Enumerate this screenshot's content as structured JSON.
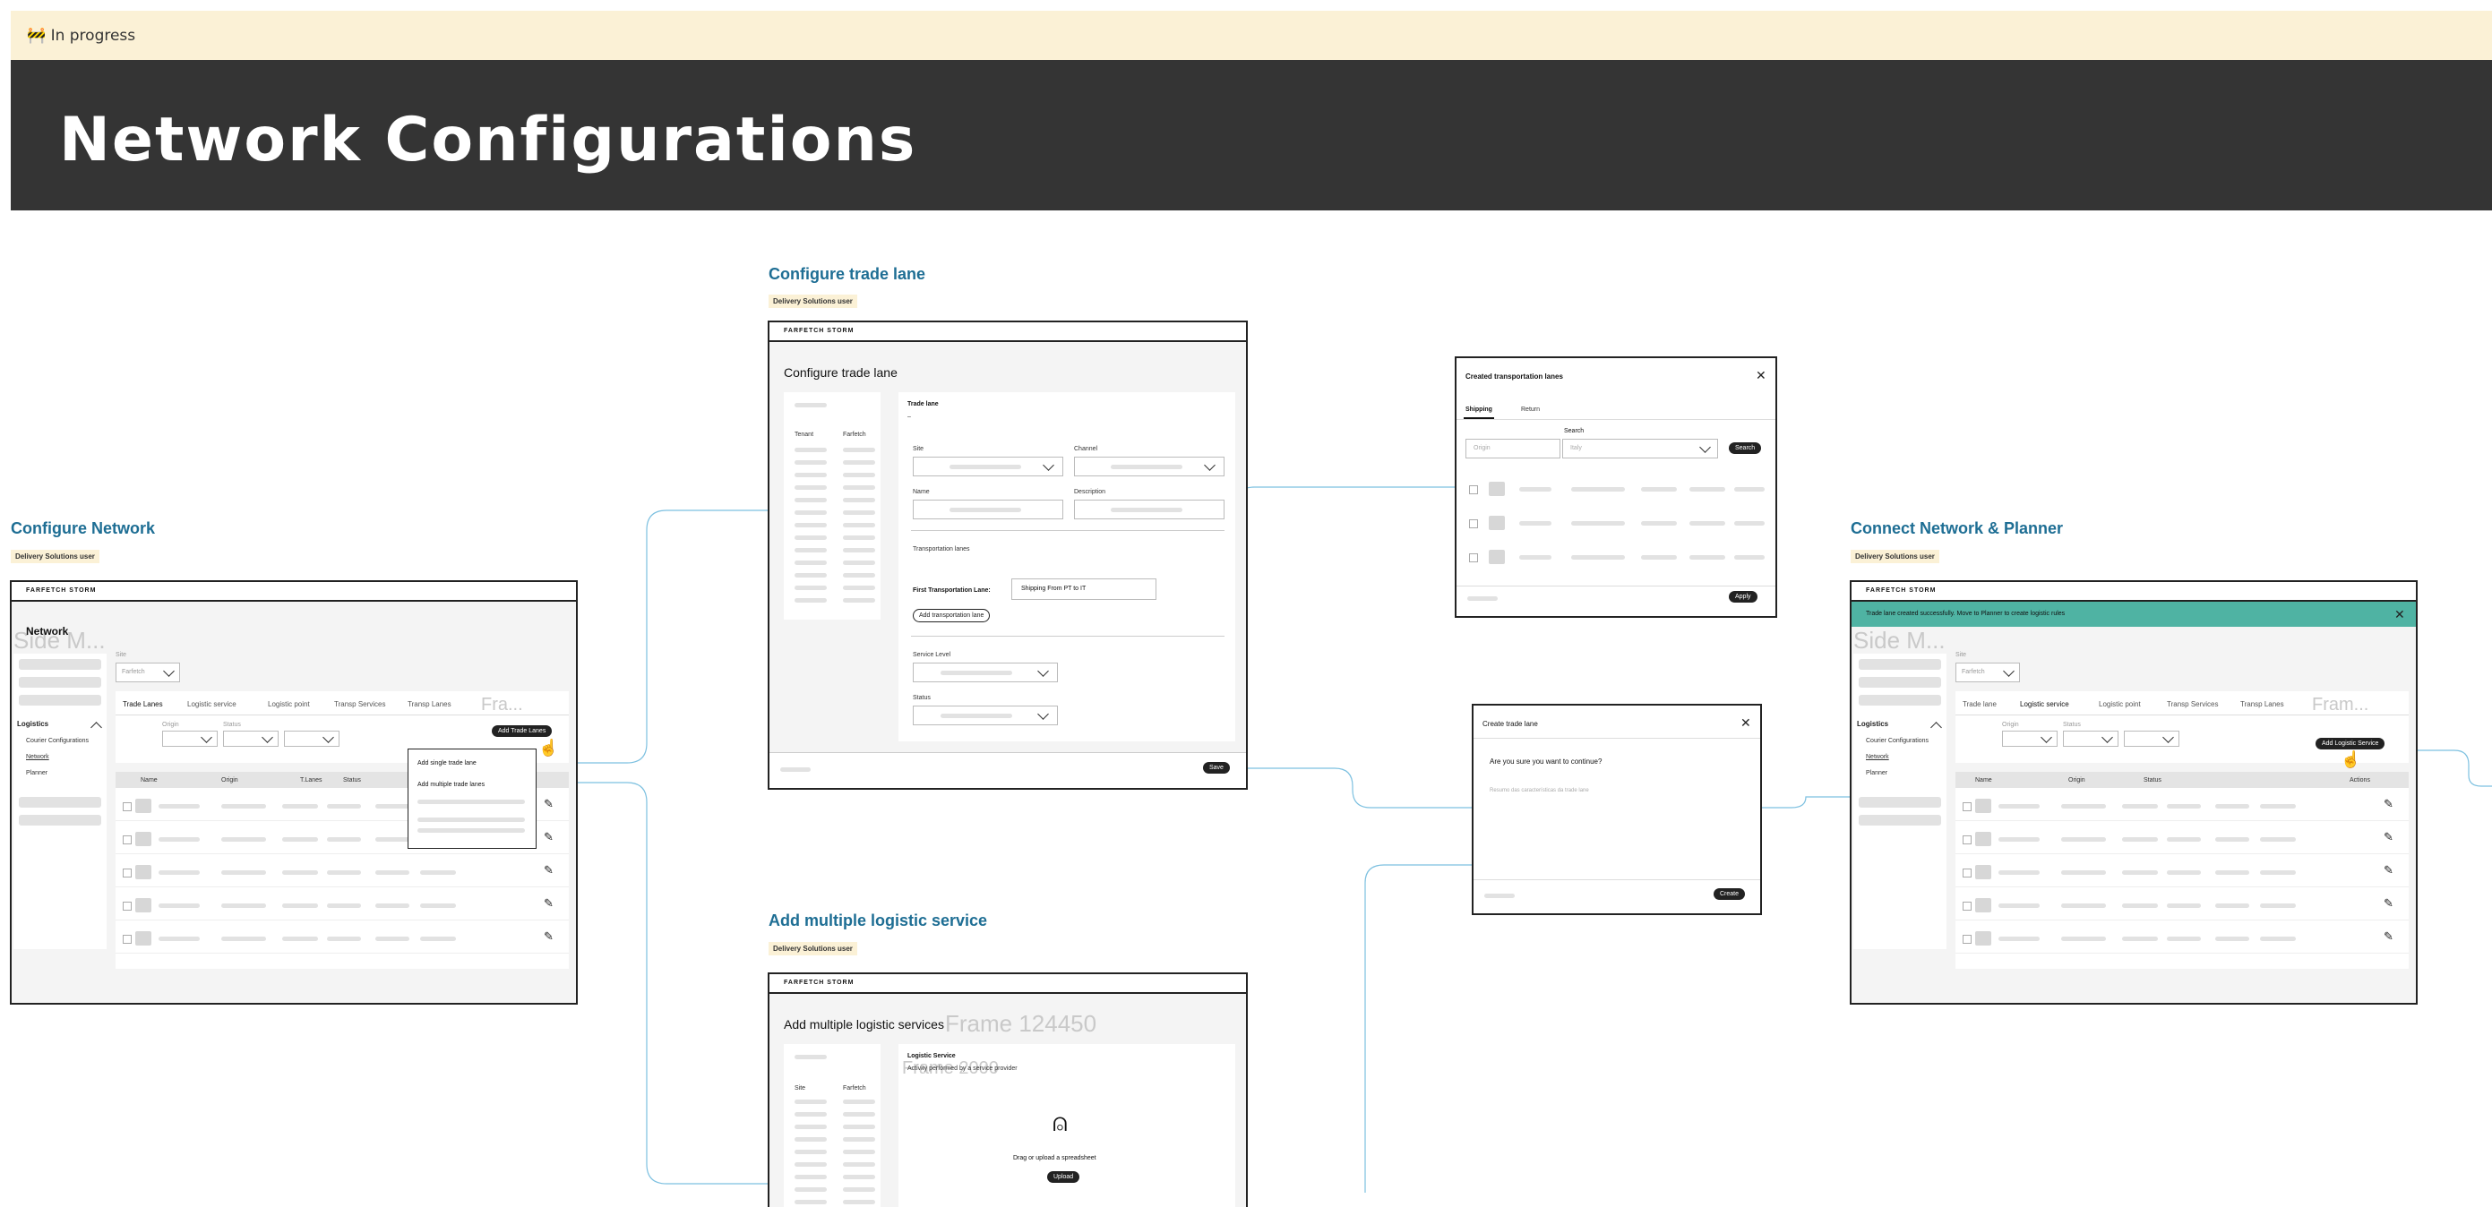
{
  "banner": {
    "icon": "construction-barrier-icon",
    "text": "🚧 In progress"
  },
  "hero": {
    "title": "Network Configurations"
  },
  "colors": {
    "accent": "#1e6e94",
    "success": "#4fb3a3",
    "tag_bg": "#fbf1d6",
    "dark": "#343434"
  },
  "configure_network": {
    "title": "Configure Network",
    "tag": "Delivery Solutions user",
    "brand": "FARFETCH STORM",
    "ghost": "Side M...",
    "heading": "Network",
    "site_label": "Site",
    "site_value": "Farfetch",
    "nav_section": "Logistics",
    "nav_items": [
      "Courier Configurations",
      "Network",
      "Planner"
    ],
    "tabs": [
      "Trade Lanes",
      "Logistic service",
      "Logistic point",
      "Transp Services",
      "Transp Lanes"
    ],
    "tab_ghost": "Fra...",
    "filters": [
      "Origin",
      "Status"
    ],
    "add_button": "Add Trade Lanes",
    "menu_items": [
      "Add single trade lane",
      "Add multiple trade lanes"
    ],
    "columns": [
      "Name",
      "Origin",
      "T.Lanes",
      "Status"
    ]
  },
  "configure_trade_lane": {
    "title": "Configure trade lane",
    "tag": "Delivery Solutions user",
    "brand": "FARFETCH STORM",
    "heading": "Configure trade lane",
    "side_labels": [
      "Tenant",
      "Farfetch"
    ],
    "section": "Trade lane",
    "dash": "–",
    "fields": [
      "Site",
      "Channel",
      "Name",
      "Description"
    ],
    "transport_label": "Transportation lanes",
    "first_lane_label": "First Transportation Lane:",
    "first_lane_value": "Shipping From PT to IT",
    "add_lane_button": "Add transportation lane",
    "service_level": "Service Level",
    "status": "Status",
    "save": "Save"
  },
  "created_lanes": {
    "title": "Created transportation lanes",
    "tabs": [
      "Shipping",
      "Return"
    ],
    "origin_placeholder": "Origin",
    "search_label": "Search",
    "search_placeholder": "Italy",
    "search_button": "Search",
    "apply": "Apply"
  },
  "create_trade_lane": {
    "title": "Create trade lane",
    "question": "Are you sure you want to continue?",
    "summary": "Resumo das características da trade lane",
    "create": "Create"
  },
  "add_logistic": {
    "title": "Add multiple logistic service",
    "tag": "Delivery Solutions user",
    "brand": "FARFETCH STORM",
    "heading": "Add multiple logistic services",
    "ghost1": "Frame 124450",
    "ghost2": "Frame 2000",
    "side_labels": [
      "Site",
      "Farfetch"
    ],
    "service_label": "Logistic Service",
    "service_desc": "Activity performed by a service provider",
    "drop_text": "Drag or upload a spreadsheet",
    "upload": "Upload"
  },
  "connect": {
    "title": "Connect Network & Planner",
    "tag": "Delivery Solutions user",
    "brand": "FARFETCH STORM",
    "toast": "Trade lane created successfully. Move to Planner to create logistic rules",
    "ghost": "Side M...",
    "site_label": "Site",
    "site_value": "Farfetch",
    "nav_section": "Logistics",
    "nav_items": [
      "Courier Configurations",
      "Network",
      "Planner"
    ],
    "tabs": [
      "Trade lane",
      "Logistic service",
      "Logistic point",
      "Transp Services",
      "Transp Lanes"
    ],
    "tab_ghost": "Fram...",
    "filters": [
      "Origin",
      "Status"
    ],
    "add_button": "Add Logistic Service",
    "columns": [
      "Name",
      "Origin",
      "Status",
      "Actions"
    ]
  }
}
